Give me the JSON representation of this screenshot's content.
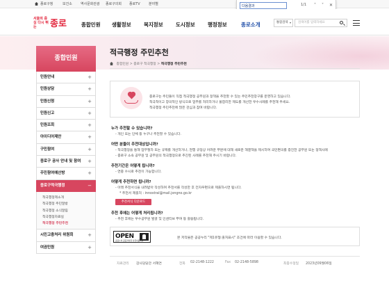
{
  "util": {
    "items": [
      "종로구청",
      "보건소",
      "역사문화관광",
      "종로구의회",
      "종로TV",
      "분야별"
    ]
  },
  "findbar": {
    "query": "다음결과",
    "count": "1/1",
    "prev": "˄",
    "next": "˅",
    "close": "✕"
  },
  "header": {
    "logo_mark": "서울의 중심 다시 뛰는",
    "logo_name": "종로",
    "nav": [
      "종합민원",
      "생활정보",
      "복지정보",
      "도시정보",
      "행정정보",
      "종로소개"
    ],
    "active_nav": "종로소개",
    "search_scope": "통합검색",
    "search_placeholder": "검색어를 입력하세요"
  },
  "sidebar": {
    "title": "종합민원",
    "items": [
      "민원안내",
      "민원상담",
      "민원신청",
      "민원신고",
      "민원조회",
      "아이디어제안",
      "구민참여",
      "종로구 공사 안내 및 참여",
      "주민참여예산방",
      "종로구적극행정",
      "시민고충처리 위원회",
      "여권민원"
    ],
    "active_item": "종로구적극행정",
    "sub_items": [
      "적극행정제소개",
      "적극행정 주민알방",
      "적극행정 소식알림",
      "적극행정자료실",
      "적극행정 주민추천"
    ],
    "current_sub": "적극행정 주민추천"
  },
  "content": {
    "title": "적극행정 주민추천",
    "breadcrumb": [
      "종합민원",
      "종로구 적극행정",
      "적극행정 주민추천"
    ],
    "intro": [
      "종로구는 주민들이 직접 적극행정 공무원과 정책을 추천할 수 있는 주민추천창구를 운영하고 있습니다.",
      "적극적이고 창의적인 방식으로 업무를 처리하거나 불합리한 제도를 개선한 우수사례를 추천해 주세요.",
      "적극행정 주민추천에 많은 관심과 참여 바랍니다."
    ],
    "sections": [
      {
        "heading": "누가 추천할 수 있습니까?",
        "lines": [
          "- 개인 또는 단체 등 누구나 추천할 수 있습니다."
        ]
      },
      {
        "heading": "어떤 분들이 추천대상입니까?",
        "lines": [
          "- 적극행정을 통해 업무절차 또는 규제를 개선하거나, 현행 규정상 어려운 부분에 대해 새로운 해결책을 제시하여 국민편의를 증진한 공무원 또는 정책사례",
          "- 종로구 소속 공무원 및 공무원의 적극행정으로 추진된 사례를 추천해 주시기 바랍니다."
        ]
      },
      {
        "heading": "추천기간은 어떻게 됩니까?",
        "lines": [
          "- 연중 수시로 추천이 가능합니다."
        ]
      },
      {
        "heading": "어떻게 추천하면 됩니까?",
        "lines": [
          "- 아래 추천서식을 내려받아 작성하여 추천서를 작성한 후 전자우편으로 제출하시면 됩니다.",
          "* 추천서 제출처 : innostral@mail.jongno.go.kr"
        ],
        "button": "추천서식 다운로드"
      },
      {
        "heading": "추천 후에는 어떻게 처리됩니까?",
        "lines": [
          "- 추천 후에는 우수공무원 발굴 및 인센티브 부여 등 활용됩니다."
        ]
      }
    ],
    "license": {
      "logo": "OPEN",
      "logo_sub": "공공누리 공공저작물 자유이용허락",
      "text": "본 저작물은 공공누리 \"제1유형:출처표시\" 조건에 따라 이용할 수 있습니다."
    }
  },
  "footer": {
    "dept_label": "자료관리",
    "dept": "감사담당관 서혜연",
    "tel_label": "전화",
    "tel": "02-2148-1222",
    "fax_label": "Fax",
    "fax": "02-2148-5898",
    "date_label": "최종수정일",
    "date": "2023년09월06일"
  },
  "colors": {
    "accent": "#d7465f",
    "nav_active": "#1f4ea8"
  }
}
